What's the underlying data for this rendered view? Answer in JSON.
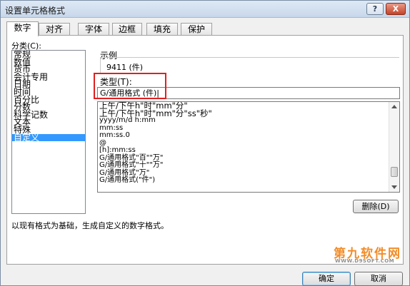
{
  "window": {
    "title": "设置单元格格式",
    "help_label": "?",
    "close_label": "X"
  },
  "tabs": [
    {
      "label": "数字"
    },
    {
      "label": "对齐"
    },
    {
      "label": "字体"
    },
    {
      "label": "边框"
    },
    {
      "label": "填充"
    },
    {
      "label": "保护"
    }
  ],
  "category": {
    "label": "分类(C):",
    "items": [
      "常规",
      "数值",
      "货币",
      "会计专用",
      "日期",
      "时间",
      "百分比",
      "分数",
      "科学记数",
      "文本",
      "特殊",
      "自定义"
    ],
    "selected": "自定义"
  },
  "sample": {
    "label": "示例",
    "value": "9411 (件)"
  },
  "type": {
    "label": "类型(T):",
    "value": "G/通用格式 (件)|"
  },
  "formats": [
    "上午/下午h\"时\"mm\"分\"",
    "上午/下午h\"时\"mm\"分\"ss\"秒\"",
    "yyyy/m/d h:mm",
    "mm:ss",
    "mm:ss.0",
    "@",
    "[h]:mm:ss",
    "G/通用格式\"百\"\"万\"",
    "G/通用格式\"十\"\"万\"",
    "G/通用格式\"万\"",
    "G/通用格式(\"件\")"
  ],
  "delete_label": "删除(D)",
  "description": "以现有格式为基础，生成自定义的数字格式。",
  "watermark": {
    "main": "第九软件网",
    "sub": "WWW.D9SOFT.COM"
  },
  "buttons": {
    "ok": "确定",
    "cancel": "取消"
  },
  "colors": {
    "selection": "#3399ff",
    "highlight_frame": "#e02020",
    "watermark": "#f28c28"
  }
}
